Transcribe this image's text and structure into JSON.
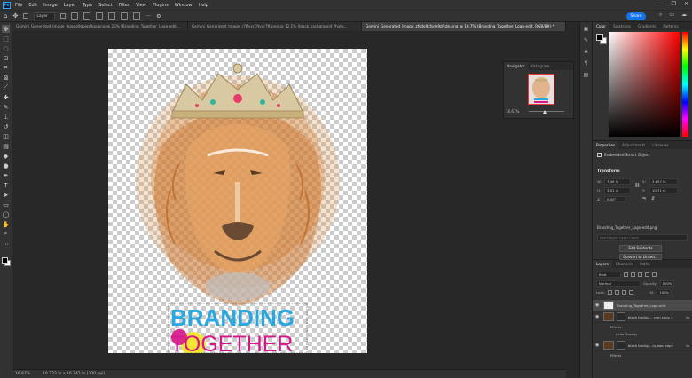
{
  "app": {
    "logo": "Ps"
  },
  "menu": [
    "File",
    "Edit",
    "Image",
    "Layer",
    "Type",
    "Select",
    "Filter",
    "View",
    "Plugins",
    "Window",
    "Help"
  ],
  "window_controls": {
    "minimize": "—",
    "restore": "❐",
    "close": "✕"
  },
  "options_bar": {
    "auto_select_value": "Layer",
    "share_label": "Share"
  },
  "tabs": [
    {
      "label": "Gemini_Generated_Image_9qowz9qowz9qo.png @ 25% (Branding_Together_Logo-edit...",
      "active": false
    },
    {
      "label": "Gemini_Generated_Image_r7ftyxr7ftyxr7ft.png @ 12.1% (black background Photo...",
      "active": false
    },
    {
      "label": "Gemini_Generated_Image_zfsde9zfsde9zfsde.png @ 16.7% (Branding_Together_Logo-edit, RGB/8#) *",
      "active": true
    }
  ],
  "canvas": {
    "brand_line1": "BRANDING",
    "brand_line2_a": "TOGE",
    "brand_line2_b": "THER",
    "colors": {
      "cyan": "#29a8e0",
      "magenta": "#d6168b",
      "yellow": "#f5e634",
      "lion": "#d98a3e",
      "crown": "#c8b07a"
    }
  },
  "status_bar": {
    "zoom": "16.67%",
    "dimensions": "16.223 in x 16.742 in (300 ppi)"
  },
  "navigator": {
    "tab_active": "Navigator",
    "tab_other": "Histogram",
    "zoom": "16.67%",
    "zoom_fraction": 0.42
  },
  "color_panel": {
    "tabs": [
      "Color",
      "Swatches",
      "Gradients",
      "Patterns"
    ]
  },
  "properties": {
    "tabs": [
      "Properties",
      "Adjustments",
      "Libraries"
    ],
    "object_type": "Embedded Smart Object",
    "section": "Transform",
    "w_label": "W:",
    "w_value": "7.49 in",
    "h_label": "H:",
    "h_value": "3.01 in",
    "x_label": "X:",
    "x_value": "3.657 in",
    "y_label": "Y:",
    "y_value": "10.71 in",
    "angle_value": "0.00°",
    "filename": "Branding_Together_Logo-edit.png",
    "notes_placeholder": "Don't Apply Layer Comp",
    "edit_button": "Edit Contents",
    "convert_button": "Convert to Linked..."
  },
  "layers": {
    "tabs": [
      "Layers",
      "Channels",
      "Paths"
    ],
    "kind": "Kind",
    "blend_mode": "Normal",
    "opacity_label": "Opacity:",
    "opacity": "100%",
    "lock_label": "Lock:",
    "fill_label": "Fill:",
    "fill": "100%",
    "items": [
      {
        "name": "Branding_Together_Logo-edit",
        "selected": true
      },
      {
        "name": "black backg.... cien copy 2",
        "selected": false
      },
      {
        "name": "Effects",
        "fx": true
      },
      {
        "name": "Color Overlay",
        "fx": true
      },
      {
        "name": "black backg....ry-own copy",
        "selected": false
      },
      {
        "name": "Effects",
        "fx": true
      }
    ]
  }
}
